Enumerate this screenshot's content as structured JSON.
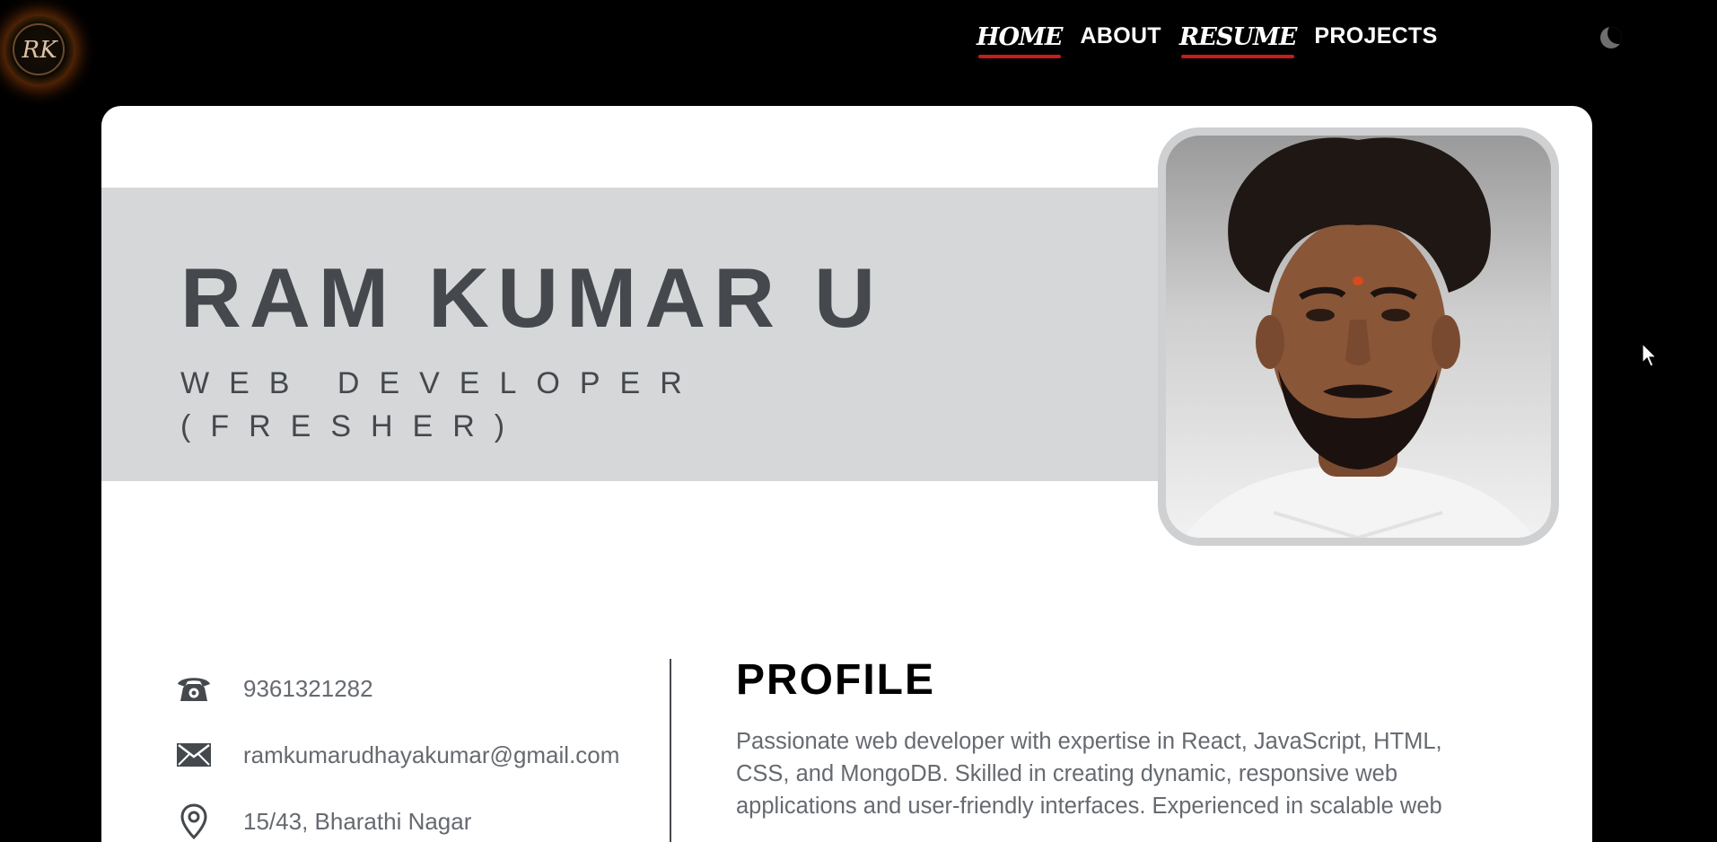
{
  "nav": {
    "items": [
      {
        "label": "HOME",
        "active": true,
        "style": "script"
      },
      {
        "label": "ABOUT",
        "active": false,
        "style": "plain"
      },
      {
        "label": "RESUME",
        "active": true,
        "style": "script"
      },
      {
        "label": "PROJECTS",
        "active": false,
        "style": "plain"
      }
    ],
    "theme_toggle_icon": "moon-icon"
  },
  "logo": {
    "text": "RK"
  },
  "resume": {
    "name": "RAM KUMAR U",
    "role_line1": "WEB DEVELOPER",
    "role_line2": "(FRESHER)",
    "contact": {
      "phone": "9361321282",
      "email": "ramkumarudhayakumar@gmail.com",
      "address": "15/43, Bharathi Nagar"
    },
    "profile": {
      "title": "PROFILE",
      "text": "Passionate web developer with expertise in React, JavaScript, HTML, CSS, and MongoDB. Skilled in creating dynamic, responsive web applications and user-friendly interfaces. Experienced in scalable web"
    }
  },
  "colors": {
    "background": "#000000",
    "nav_underline": "#c81b1b",
    "band": "#d6d7d8",
    "name": "#45484d",
    "body_text": "#666a70"
  }
}
